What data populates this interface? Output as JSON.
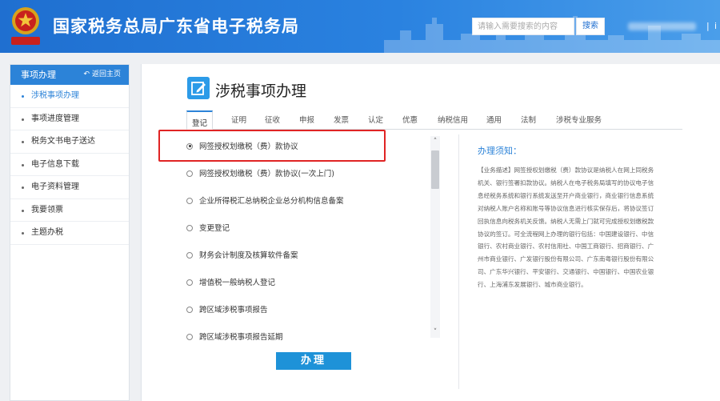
{
  "header": {
    "site_title": "国家税务总局广东省电子税务局",
    "emblem_text": "中国税务",
    "search_placeholder": "请输入需要搜索的内容",
    "search_button": "搜索",
    "separator": "|",
    "right_end": "i"
  },
  "sidebar": {
    "heading": "事项办理",
    "back_label": "返回主页",
    "items": [
      {
        "label": "涉税事项办理",
        "active": true
      },
      {
        "label": "事项进度管理",
        "active": false
      },
      {
        "label": "税务文书电子送达",
        "active": false
      },
      {
        "label": "电子信息下载",
        "active": false
      },
      {
        "label": "电子资料管理",
        "active": false
      },
      {
        "label": "我要领票",
        "active": false
      },
      {
        "label": "主题办税",
        "active": false
      }
    ]
  },
  "main": {
    "page_title": "涉税事项办理",
    "tabs": [
      "登记",
      "证明",
      "征收",
      "申报",
      "发票",
      "认定",
      "优惠",
      "纳税信用",
      "通用",
      "法制",
      "涉税专业服务"
    ],
    "active_tab": "登记",
    "options": [
      {
        "label": "网签授权划缴税（费）款协议",
        "selected": true
      },
      {
        "label": "网签授权划缴税（费）款协议(一次上门)",
        "selected": false
      },
      {
        "label": "企业所得税汇总纳税企业总分机构信息备案",
        "selected": false
      },
      {
        "label": "变更登记",
        "selected": false
      },
      {
        "label": "财务会计制度及核算软件备案",
        "selected": false
      },
      {
        "label": "增值税一般纳税人登记",
        "selected": false
      },
      {
        "label": "跨区域涉税事项报告",
        "selected": false
      },
      {
        "label": "跨区域涉税事项报告延期",
        "selected": false
      }
    ],
    "submit_label": "办理",
    "notice_title": "办理须知：",
    "notice_lines": [
      "【业务描述】网签授权划缴税（费）款协议是纳税人在网上同税务",
      "机关、银行签署扣款协议。纳税人在电子税务局填写的协议电子信",
      "息经税务系统和银行系统发送至开户商业银行，商业银行信息系统",
      "对纳税人账户名称和账号等协议信息进行核实保存后，将协议签订",
      "回执信息向税务机关反馈。纳税人无需上门就可完成授权划缴税款",
      "协议的签订。可全流程网上办理的银行包括：中国建设银行、中信",
      "银行、农村商业银行、农村信用社、中国工商银行、招商银行、广",
      "州市商业银行、广发银行股份有限公司、广东南粤银行股份有限公",
      "司、广东华兴银行、平安银行、交通银行、中国银行、中国农业银",
      "行、上海浦东发展银行、城市商业银行。"
    ]
  },
  "colors": {
    "header_blue": "#1f6fd0",
    "accent": "#2c83d8",
    "button": "#1e92d8",
    "highlight_red": "#e02424"
  }
}
